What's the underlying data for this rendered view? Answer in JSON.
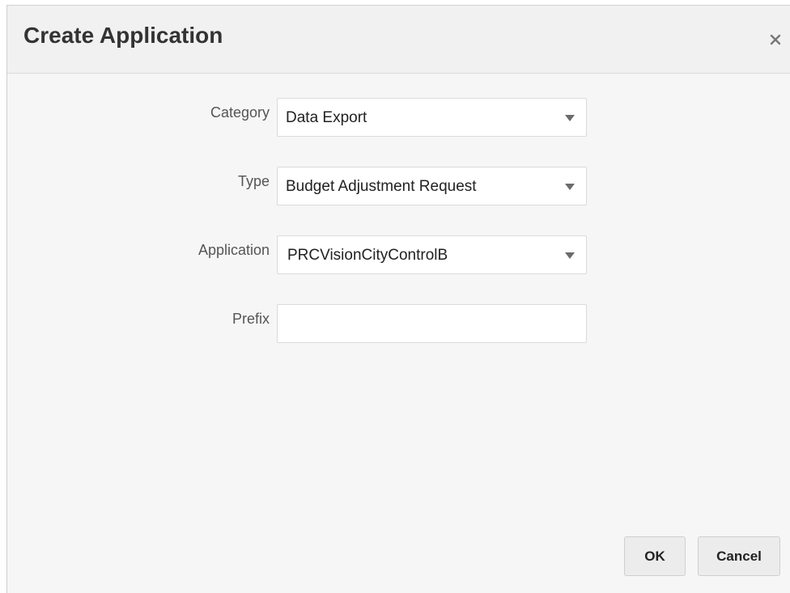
{
  "dialog": {
    "title": "Create Application",
    "close_icon": "close-icon"
  },
  "form": {
    "category": {
      "label": "Category",
      "value": "Data Export"
    },
    "type": {
      "label": "Type",
      "value": "Budget Adjustment Request"
    },
    "application": {
      "label": "Application",
      "value": "PRCVisionCityControlB"
    },
    "prefix": {
      "label": "Prefix",
      "value": ""
    }
  },
  "buttons": {
    "ok_label": "OK",
    "cancel_label": "Cancel"
  }
}
